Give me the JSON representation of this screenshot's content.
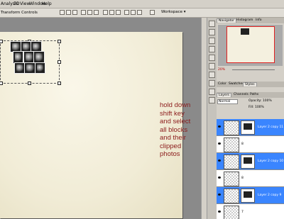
{
  "menu": {
    "items": [
      "Analysis",
      "3D",
      "View",
      "Window",
      "Help"
    ]
  },
  "options": {
    "transform_label": "Transform Controls",
    "workspace_label": "Workspace ▾"
  },
  "annotation": {
    "lines": [
      "hold down",
      "shift key",
      "and select",
      "all blocks",
      "and their",
      "clipped",
      "photos"
    ]
  },
  "panels": {
    "nav_tabs": [
      "Navigator",
      "Histogram",
      "Info"
    ],
    "zoom_value": "20%",
    "color_tabs": [
      "Color",
      "Swatches",
      "Styles"
    ],
    "layer_tabs": [
      "Layers",
      "Channels",
      "Paths"
    ],
    "blend_mode": "Normal",
    "opacity": "Opacity: 100%",
    "fill": "Fill: 100%"
  },
  "layers": [
    {
      "name": "Layer 2 copy 11",
      "selected": true,
      "has_mask": true
    },
    {
      "name": "8",
      "selected": false,
      "has_mask": false
    },
    {
      "name": "Layer 2 copy 10",
      "selected": true,
      "has_mask": true
    },
    {
      "name": "8",
      "selected": false,
      "has_mask": false
    },
    {
      "name": "Layer 2 copy 9",
      "selected": true,
      "has_mask": true
    },
    {
      "name": "7",
      "selected": false,
      "has_mask": false
    }
  ]
}
